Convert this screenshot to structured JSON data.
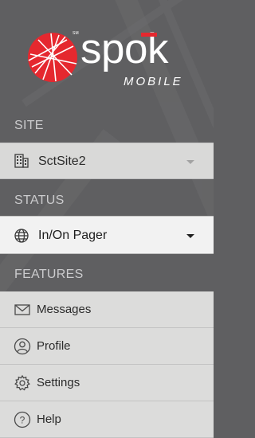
{
  "colors": {
    "background": "#5f5f61",
    "row_background": "#d9d9d8",
    "accent_red": "#e5282f",
    "section_label": "#cbcbcd"
  },
  "brand": {
    "trademark": "SM",
    "wordmark": "spok",
    "subtitle": "MOBILE"
  },
  "site": {
    "section_label": "SITE",
    "icon": "building-icon",
    "selected_value": "SctSite2"
  },
  "status": {
    "section_label": "STATUS",
    "icon": "globe-icon",
    "selected_value": "In/On Pager"
  },
  "features": {
    "section_label": "FEATURES",
    "items": [
      {
        "label": "Messages",
        "icon": "envelope-icon"
      },
      {
        "label": "Profile",
        "icon": "person-icon"
      },
      {
        "label": "Settings",
        "icon": "gear-icon"
      },
      {
        "label": "Help",
        "icon": "question-icon"
      }
    ]
  }
}
